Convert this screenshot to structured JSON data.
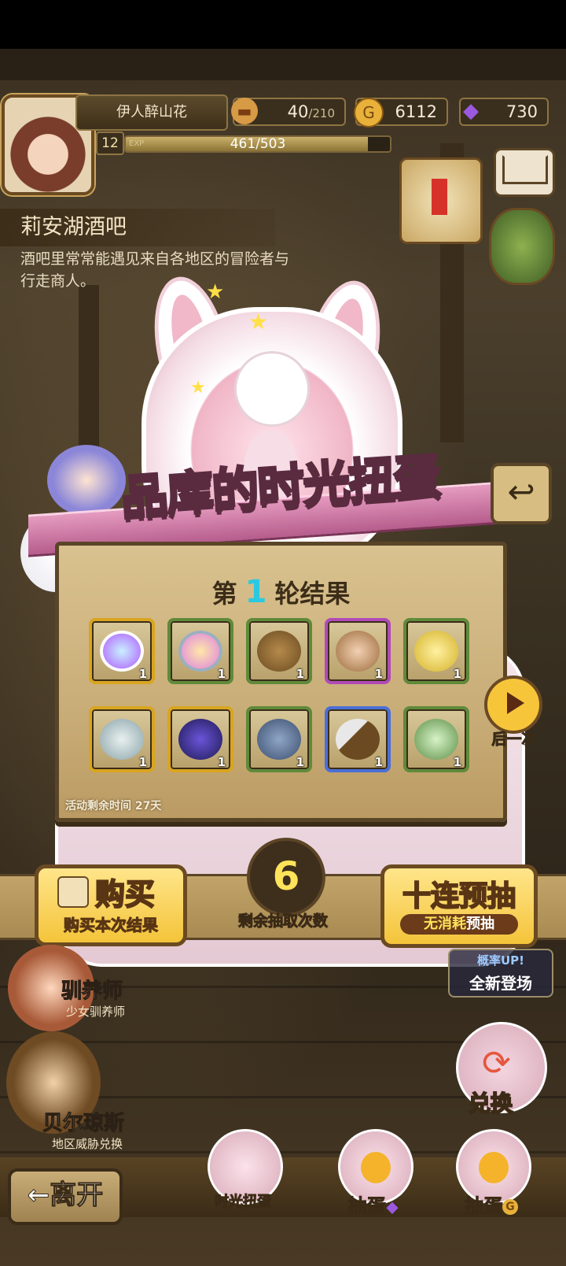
{
  "player": {
    "name": "伊人醉山花",
    "level": "12",
    "exp_label": "EXP",
    "exp_value": "461/503",
    "exp_fraction": 0.9165
  },
  "resources": {
    "stamina": {
      "icon": "bread-icon",
      "current": "40",
      "max": "/210"
    },
    "gold": {
      "icon": "gold-coin-icon",
      "value": "6112"
    },
    "gems": {
      "icon": "purple-gem-icon",
      "value": "730"
    }
  },
  "location": {
    "title": "莉安湖酒吧",
    "description": "酒吧里常常能遇见来自各地区的冒险者与行走商人。"
  },
  "event": {
    "title_part1": "品库的",
    "title_highlight": "时光",
    "title_part2": "扭蛋",
    "round_prefix": "第",
    "round_number": "1",
    "round_suffix": "轮结果",
    "time_left": "活动剩余时间  27天",
    "items": [
      {
        "name": "angel-wing-egg",
        "count": "1",
        "rarity": "gold"
      },
      {
        "name": "capsule-machine",
        "count": "1",
        "rarity": "green"
      },
      {
        "name": "wooden-barrel",
        "count": "1",
        "rarity": "green"
      },
      {
        "name": "nest-egg",
        "count": "1",
        "rarity": "purple"
      },
      {
        "name": "gold-egg",
        "count": "1",
        "rarity": "green"
      },
      {
        "name": "silver-ore",
        "count": "1",
        "rarity": "gold"
      },
      {
        "name": "dark-crystal",
        "count": "1",
        "rarity": "gold"
      },
      {
        "name": "seashell",
        "count": "1",
        "rarity": "green"
      },
      {
        "name": "cleaver",
        "count": "1",
        "rarity": "blue"
      },
      {
        "name": "green-egg",
        "count": "1",
        "rarity": "green"
      }
    ],
    "next_label": "后一次",
    "draws_left": "6",
    "draws_left_label": "剩余抽取次数"
  },
  "actions": {
    "buy_title": "购买",
    "buy_subtitle": "购买本次结果",
    "ten_title": "十连预抽",
    "ten_sub_a": "无消耗",
    "ten_sub_b": "预抽"
  },
  "promo": {
    "line1": "概率UP!",
    "line2": "全新登场"
  },
  "npcs": [
    {
      "name": "驯养师",
      "subtitle": "少女驯养师"
    },
    {
      "name": "贝尔琼斯",
      "subtitle": "地区威胁兑换"
    }
  ],
  "exchange_label": "兑换",
  "leave_label": "←离开",
  "dock": [
    {
      "label": "时光扭蛋"
    },
    {
      "label": "抽蛋"
    },
    {
      "label": "抽蛋"
    }
  ],
  "colors": {
    "rarity_gold": "#d9a520",
    "rarity_green": "#5f8a3a",
    "rarity_purple": "#b04ab8",
    "rarity_blue": "#4a6fd6",
    "accent_yellow": "#f4c43a",
    "round_number": "#2bc9e0"
  }
}
